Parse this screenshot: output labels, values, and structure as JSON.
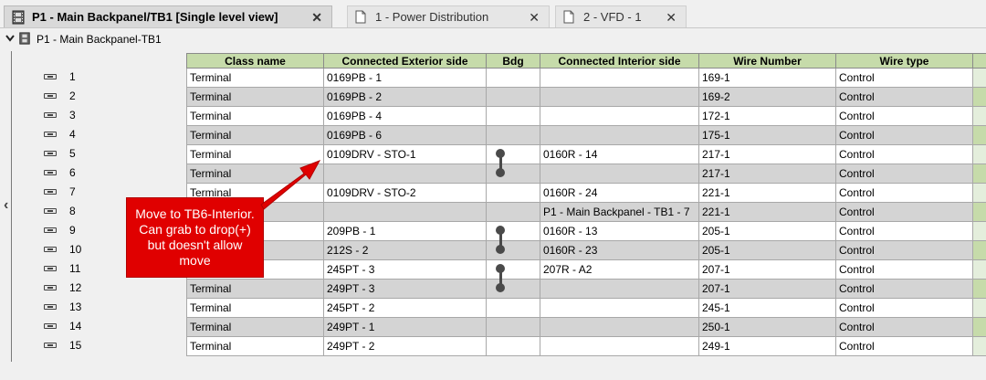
{
  "tabs": [
    {
      "label": "P1 - Main Backpanel/TB1 [Single level view]",
      "active": true,
      "close": "✕"
    },
    {
      "label": "1 - Power Distribution",
      "active": false,
      "close": "✕"
    },
    {
      "label": "2 - VFD - 1",
      "active": false,
      "close": "✕"
    }
  ],
  "breadcrumb": {
    "label": "P1 - Main Backpanel-TB1"
  },
  "grid": {
    "columns": [
      "Class name",
      "Connected Exterior side",
      "Bdg",
      "Connected Interior side",
      "Wire Number",
      "Wire type"
    ],
    "rows": [
      {
        "num": "1",
        "class": "Terminal",
        "exterior": "0169PB - 1",
        "interior": "",
        "wire": "169-1",
        "type": "Control"
      },
      {
        "num": "2",
        "class": "Terminal",
        "exterior": "0169PB - 2",
        "interior": "",
        "wire": "169-2",
        "type": "Control"
      },
      {
        "num": "3",
        "class": "Terminal",
        "exterior": "0169PB - 4",
        "interior": "",
        "wire": "172-1",
        "type": "Control"
      },
      {
        "num": "4",
        "class": "Terminal",
        "exterior": "0169PB - 6",
        "interior": "",
        "wire": "175-1",
        "type": "Control"
      },
      {
        "num": "5",
        "class": "Terminal",
        "exterior": "0109DRV - STO-1",
        "interior": "0160R - 14",
        "wire": "217-1",
        "type": "Control"
      },
      {
        "num": "6",
        "class": "Terminal",
        "exterior": "",
        "interior": "",
        "wire": "217-1",
        "type": "Control"
      },
      {
        "num": "7",
        "class": "Terminal",
        "exterior": "0109DRV - STO-2",
        "interior": "0160R - 24",
        "wire": "221-1",
        "type": "Control"
      },
      {
        "num": "8",
        "class": "",
        "exterior": "",
        "interior": "P1 - Main Backpanel - TB1 - 7",
        "wire": "221-1",
        "type": "Control"
      },
      {
        "num": "9",
        "class": "",
        "exterior": "209PB - 1",
        "interior": "0160R - 13",
        "wire": "205-1",
        "type": "Control"
      },
      {
        "num": "10",
        "class": "",
        "exterior": "212S - 2",
        "interior": "0160R - 23",
        "wire": "205-1",
        "type": "Control"
      },
      {
        "num": "11",
        "class": "",
        "exterior": "245PT - 3",
        "interior": "207R - A2",
        "wire": "207-1",
        "type": "Control"
      },
      {
        "num": "12",
        "class": "Terminal",
        "exterior": "249PT - 3",
        "interior": "",
        "wire": "207-1",
        "type": "Control"
      },
      {
        "num": "13",
        "class": "Terminal",
        "exterior": "245PT - 2",
        "interior": "",
        "wire": "245-1",
        "type": "Control"
      },
      {
        "num": "14",
        "class": "Terminal",
        "exterior": "249PT - 1",
        "interior": "",
        "wire": "250-1",
        "type": "Control"
      },
      {
        "num": "15",
        "class": "Terminal",
        "exterior": "249PT - 2",
        "interior": "",
        "wire": "249-1",
        "type": "Control"
      }
    ]
  },
  "bridges": [
    {
      "from": 5,
      "to": 6
    },
    {
      "from": 9,
      "to": 10
    },
    {
      "from": 11,
      "to": 12
    }
  ],
  "callout": {
    "text": "Move to TB6-Interior.  Can grab to drop(+) but doesn't allow move"
  },
  "colors": {
    "header": "#c6dbaa",
    "callout": "#e00000",
    "row_alt": "#d4d4d4"
  }
}
